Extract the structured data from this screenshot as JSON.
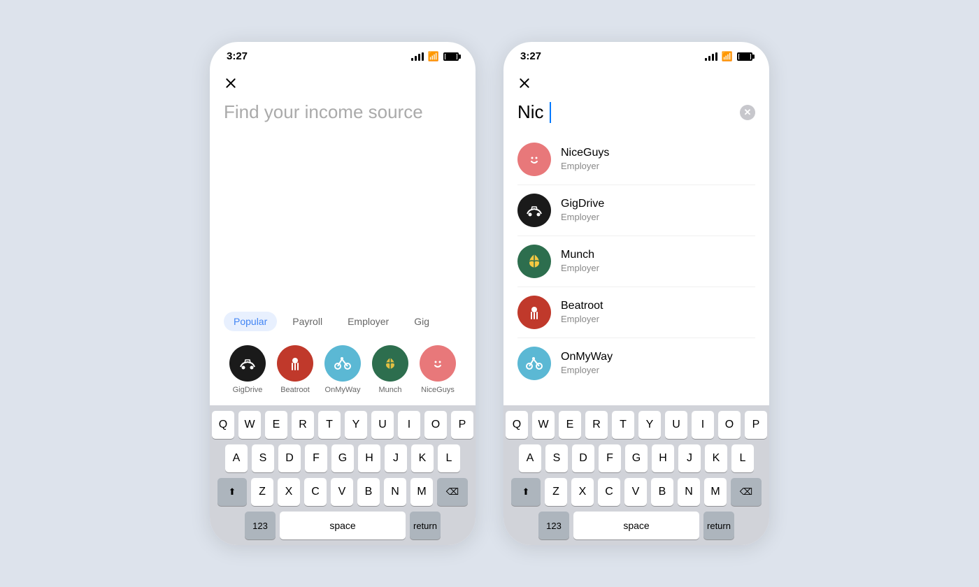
{
  "phone1": {
    "status": {
      "time": "3:27"
    },
    "search": {
      "placeholder": "Find your income source"
    },
    "tabs": [
      {
        "label": "Popular",
        "active": true
      },
      {
        "label": "Payroll",
        "active": false
      },
      {
        "label": "Employer",
        "active": false
      },
      {
        "label": "Gig",
        "active": false
      }
    ],
    "popular_items": [
      {
        "name": "GigDrive",
        "avatar_class": "avatar-gigdrive",
        "icon": "car"
      },
      {
        "name": "Beatroot",
        "avatar_class": "avatar-beatroot",
        "icon": "fork"
      },
      {
        "name": "OnMyWay",
        "avatar_class": "avatar-onmyway",
        "icon": "bike"
      },
      {
        "name": "Munch",
        "avatar_class": "avatar-munch",
        "icon": "shell"
      },
      {
        "name": "NiceGuys",
        "avatar_class": "avatar-niceguys",
        "icon": "smile"
      }
    ]
  },
  "phone2": {
    "status": {
      "time": "3:27"
    },
    "search": {
      "value": "Nic"
    },
    "results": [
      {
        "name": "NiceGuys",
        "type": "Employer",
        "avatar_class": "avatar-niceguys",
        "icon": "smile"
      },
      {
        "name": "GigDrive",
        "type": "Employer",
        "avatar_class": "avatar-gigdrive",
        "icon": "car"
      },
      {
        "name": "Munch",
        "type": "Employer",
        "avatar_class": "avatar-munch",
        "icon": "shell"
      },
      {
        "name": "Beatroot",
        "type": "Employer",
        "avatar_class": "avatar-beatroot",
        "icon": "fork"
      },
      {
        "name": "OnMyWay",
        "type": "Employer",
        "avatar_class": "avatar-onmyway",
        "icon": "bike"
      }
    ]
  },
  "keyboard": {
    "rows": [
      [
        "Q",
        "W",
        "E",
        "R",
        "T",
        "Y",
        "U",
        "I",
        "O",
        "P"
      ],
      [
        "A",
        "S",
        "D",
        "F",
        "G",
        "H",
        "J",
        "K",
        "L"
      ],
      [
        "Z",
        "X",
        "C",
        "V",
        "B",
        "N",
        "M"
      ]
    ],
    "bottom": [
      "123",
      "space",
      "return"
    ]
  }
}
